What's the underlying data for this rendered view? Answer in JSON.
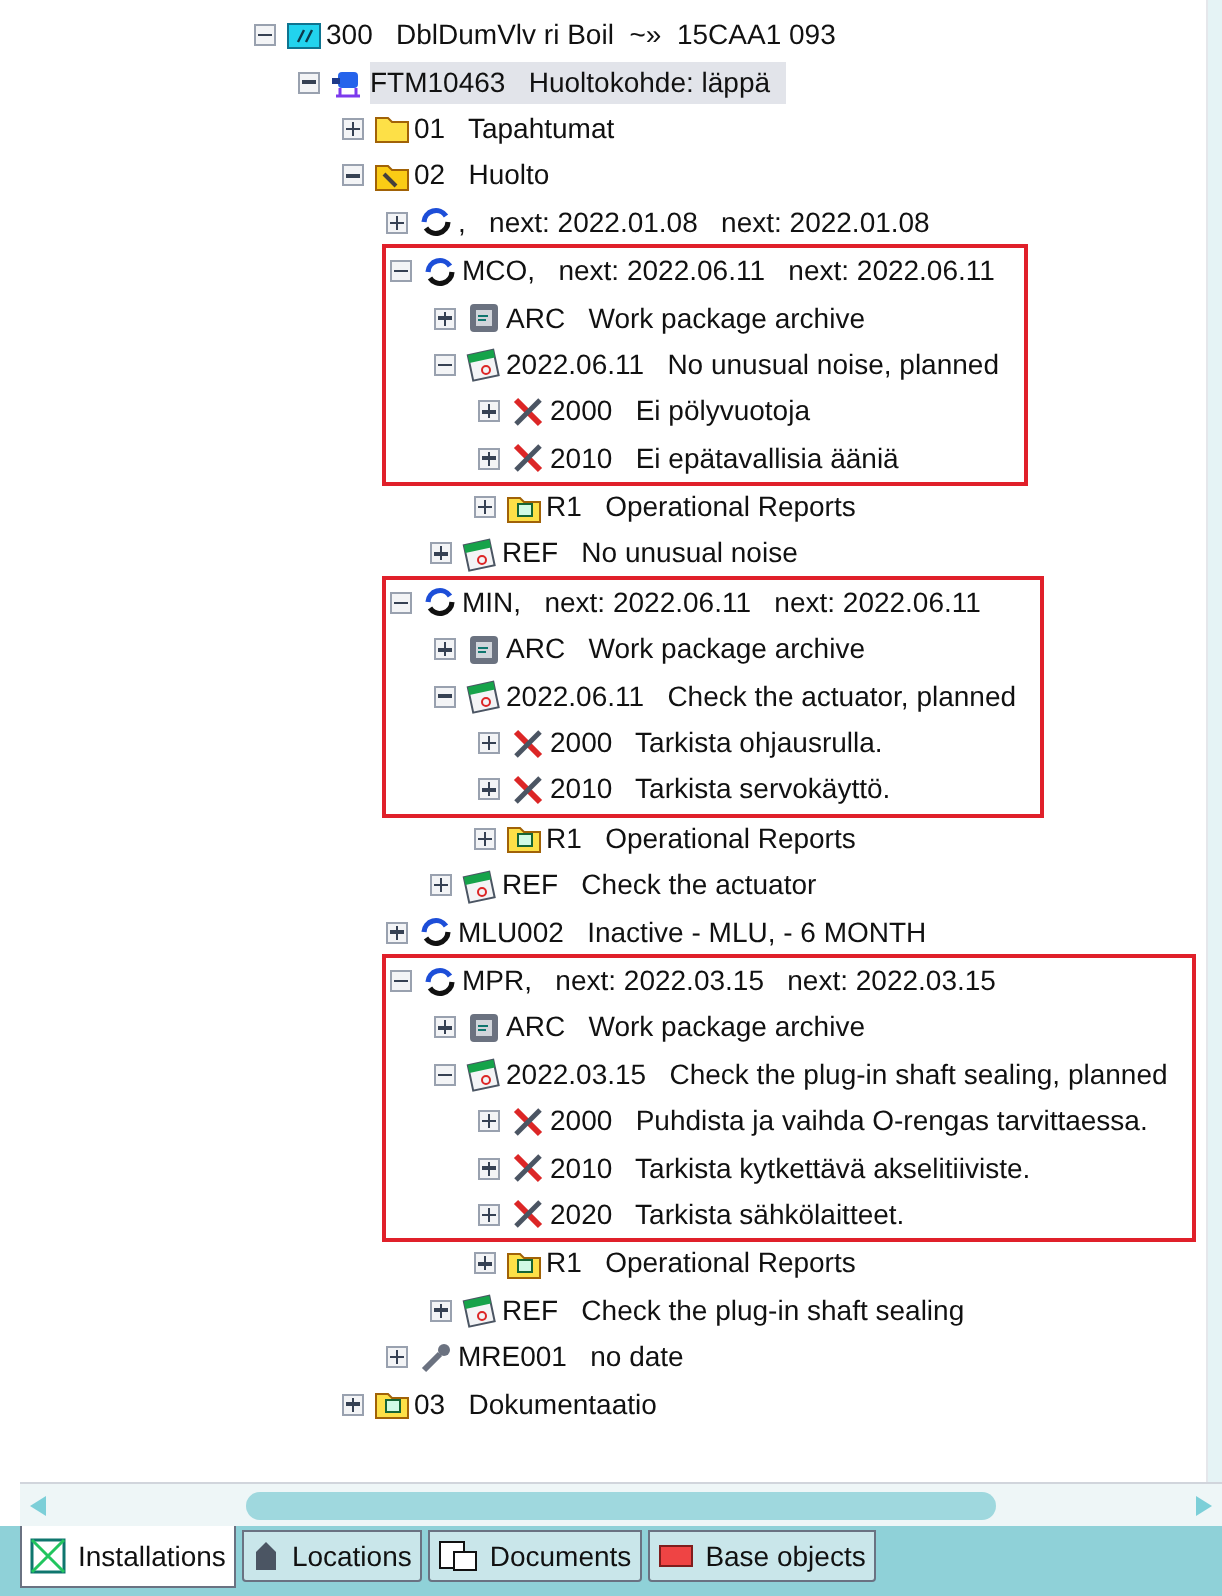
{
  "tree": [
    {
      "kind": "monitor",
      "code": "300",
      "label": "DblDumVlv ri Boil  ~»  15CAA1 093",
      "expanded": true,
      "selected": false,
      "marked": false,
      "children": [
        {
          "kind": "equipment",
          "code": "FTM10463",
          "label": "Huoltokohde: läppä",
          "expanded": true,
          "selected": true,
          "marked": false,
          "children": [
            {
              "kind": "folder",
              "code": "01",
              "label": "Tapahtumat",
              "expanded": false,
              "selected": false,
              "marked": false
            },
            {
              "kind": "tool-folder",
              "code": "02",
              "label": "Huolto",
              "expanded": true,
              "selected": false,
              "marked": false,
              "children": [
                {
                  "kind": "cycle",
                  "code": ",",
                  "label": "next: 2022.01.08   next: 2022.01.08",
                  "expanded": false,
                  "selected": false,
                  "marked": false
                },
                {
                  "kind": "cycle",
                  "code": "MCO,",
                  "label": "next: 2022.06.11   next: 2022.06.11",
                  "expanded": true,
                  "selected": false,
                  "marked": true,
                  "children": [
                    {
                      "kind": "archive",
                      "code": "ARC",
                      "label": "Work package archive",
                      "expanded": false,
                      "selected": false,
                      "marked": true
                    },
                    {
                      "kind": "calendar",
                      "code": "2022.06.11",
                      "label": "No unusual noise, planned",
                      "expanded": true,
                      "selected": false,
                      "marked": true,
                      "children": [
                        {
                          "kind": "tools",
                          "code": "2000",
                          "label": "Ei pölyvuotoja",
                          "expanded": false,
                          "selected": false,
                          "marked": true
                        },
                        {
                          "kind": "tools",
                          "code": "2010",
                          "label": "Ei epätavallisia ääniä",
                          "expanded": false,
                          "selected": false,
                          "marked": true
                        },
                        {
                          "kind": "report-folder",
                          "code": "R1",
                          "label": "Operational Reports",
                          "expanded": false,
                          "selected": false,
                          "marked": false
                        }
                      ]
                    },
                    {
                      "kind": "calendar",
                      "code": "REF",
                      "label": "No unusual noise",
                      "expanded": false,
                      "selected": false,
                      "marked": false
                    }
                  ]
                },
                {
                  "kind": "cycle",
                  "code": "MIN,",
                  "label": "next: 2022.06.11   next: 2022.06.11",
                  "expanded": true,
                  "selected": false,
                  "marked": true,
                  "children": [
                    {
                      "kind": "archive",
                      "code": "ARC",
                      "label": "Work package archive",
                      "expanded": false,
                      "selected": false,
                      "marked": true
                    },
                    {
                      "kind": "calendar",
                      "code": "2022.06.11",
                      "label": "Check the actuator, planned",
                      "expanded": true,
                      "selected": false,
                      "marked": true,
                      "children": [
                        {
                          "kind": "tools",
                          "code": "2000",
                          "label": "Tarkista ohjausrulla.",
                          "expanded": false,
                          "selected": false,
                          "marked": true
                        },
                        {
                          "kind": "tools",
                          "code": "2010",
                          "label": "Tarkista servokäyttö.",
                          "expanded": false,
                          "selected": false,
                          "marked": true
                        },
                        {
                          "kind": "report-folder",
                          "code": "R1",
                          "label": "Operational Reports",
                          "expanded": false,
                          "selected": false,
                          "marked": false
                        }
                      ]
                    },
                    {
                      "kind": "calendar",
                      "code": "REF",
                      "label": "Check the actuator",
                      "expanded": false,
                      "selected": false,
                      "marked": false
                    }
                  ]
                },
                {
                  "kind": "cycle",
                  "code": "MLU002",
                  "label": "Inactive - MLU, - 6 MONTH",
                  "expanded": false,
                  "selected": false,
                  "marked": false
                },
                {
                  "kind": "cycle",
                  "code": "MPR,",
                  "label": "next: 2022.03.15   next: 2022.03.15",
                  "expanded": true,
                  "selected": false,
                  "marked": true,
                  "children": [
                    {
                      "kind": "archive",
                      "code": "ARC",
                      "label": "Work package archive",
                      "expanded": false,
                      "selected": false,
                      "marked": true
                    },
                    {
                      "kind": "calendar",
                      "code": "2022.03.15",
                      "label": "Check the plug-in shaft sealing, planned",
                      "expanded": true,
                      "selected": false,
                      "marked": true,
                      "children": [
                        {
                          "kind": "tools",
                          "code": "2000",
                          "label": "Puhdista ja vaihda O-rengas tarvittaessa.",
                          "expanded": false,
                          "selected": false,
                          "marked": true
                        },
                        {
                          "kind": "tools",
                          "code": "2010",
                          "label": "Tarkista kytkettävä akselitiiviste.",
                          "expanded": false,
                          "selected": false,
                          "marked": true
                        },
                        {
                          "kind": "tools",
                          "code": "2020",
                          "label": "Tarkista sähkölaitteet.",
                          "expanded": false,
                          "selected": false,
                          "marked": true
                        },
                        {
                          "kind": "report-folder",
                          "code": "R1",
                          "label": "Operational Reports",
                          "expanded": false,
                          "selected": false,
                          "marked": false
                        }
                      ]
                    },
                    {
                      "kind": "calendar",
                      "code": "REF",
                      "label": "Check the plug-in shaft sealing",
                      "expanded": false,
                      "selected": false,
                      "marked": false
                    }
                  ]
                },
                {
                  "kind": "wrench",
                  "code": "MRE001",
                  "label": "no date",
                  "expanded": false,
                  "selected": false,
                  "marked": false
                }
              ]
            },
            {
              "kind": "report-folder",
              "code": "03",
              "label": "Dokumentaatio",
              "expanded": false,
              "selected": false,
              "marked": false
            }
          ]
        }
      ]
    }
  ],
  "tabs": [
    {
      "kind": "installations",
      "label": "Installations",
      "selected": true
    },
    {
      "kind": "locations",
      "label": "Locations",
      "selected": false
    },
    {
      "kind": "documents",
      "label": "Documents",
      "selected": false
    },
    {
      "kind": "base-objects",
      "label": "Base objects",
      "selected": false
    }
  ]
}
